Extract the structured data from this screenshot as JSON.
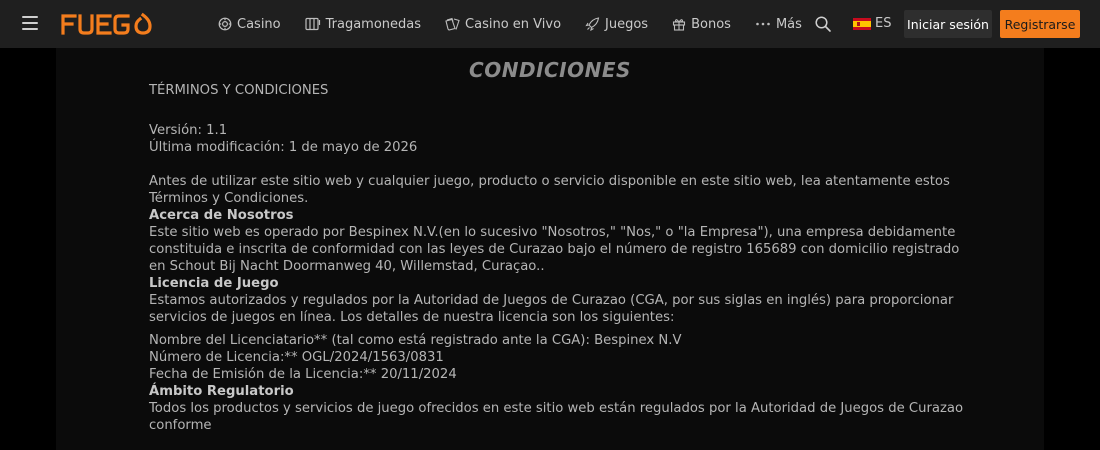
{
  "header": {
    "brand": "FUEGO",
    "nav": [
      {
        "label": "Casino",
        "icon": "casino-chip-icon"
      },
      {
        "label": "Tragamonedas",
        "icon": "slot-machine-icon"
      },
      {
        "label": "Casino en Vivo",
        "icon": "live-casino-icon"
      },
      {
        "label": "Juegos",
        "icon": "rocket-icon"
      },
      {
        "label": "Bonos",
        "icon": "gift-icon"
      },
      {
        "label": "Más",
        "icon": "more-dots-icon"
      }
    ],
    "language": "ES",
    "login_label": "Iniciar sesión",
    "register_label": "Registrarse",
    "accent_color": "#f47d1d"
  },
  "page": {
    "title": "CONDICIONES",
    "subtitle": "TÉRMINOS Y CONDICIONES",
    "version": "Versión: 1.1",
    "modified": "Última modificación: 1 de mayo de 2026",
    "intro": "Antes de utilizar este sitio web y cualquier juego, producto o servicio disponible en este sitio web, lea atentamente estos Términos y Condiciones.",
    "sections": [
      {
        "heading": "Acerca de Nosotros",
        "text": "Este sitio web es operado por Bespinex N.V.(en lo sucesivo \"Nosotros,\" \"Nos,\" o \"la Empresa\"), una empresa debidamente constituida e inscrita de conformidad con las leyes de Curazao bajo el número de registro 165689   con domicilio registrado en Schout Bij Nacht Doormanweg 40, Willemstad, Curaçao.."
      },
      {
        "heading": "Licencia de Juego",
        "text": "Estamos autorizados y regulados por la Autoridad de Juegos de Curazao (CGA, por sus siglas en inglés) para proporcionar servicios de juegos en línea. Los detalles de nuestra licencia son los siguientes:",
        "details": [
          "Nombre del Licenciatario** (tal como está registrado ante la CGA): Bespinex N.V",
          "Número de Licencia:** OGL/2024/1563/0831",
          "Fecha de Emisión de la Licencia:** 20/11/2024"
        ]
      },
      {
        "heading": "Ámbito Regulatorio",
        "text": "Todos los productos y servicios de juego ofrecidos en este sitio web están regulados por la Autoridad de Juegos de Curazao conforme"
      }
    ]
  }
}
